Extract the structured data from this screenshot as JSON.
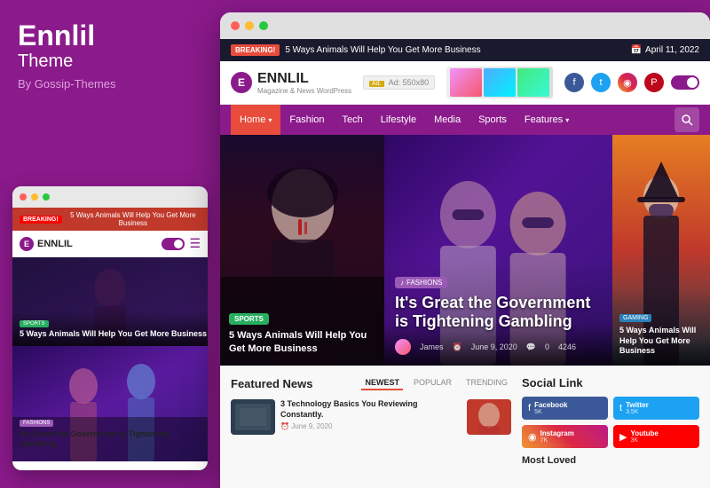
{
  "left": {
    "brand_name": "Ennlil",
    "brand_sub": "Theme",
    "brand_by": "By Gossip-Themes"
  },
  "mini_browser": {
    "breaking_badge": "BREAKING!",
    "breaking_text": "5 Ways Animals Will Help You Get More Business",
    "logo_letter": "E",
    "logo_text": "ENNLIL",
    "sports_badge": "SPORTS",
    "hero_title": "5 Ways Animals Will Help You Get More Business",
    "fashions_badge": "FASHIONS",
    "section_title": "It's Great the Government is Tightening Gambling"
  },
  "main_browser": {
    "breaking_badge": "BREAKING!",
    "breaking_text": "5 Ways Animals Will Help You Get More Business",
    "date": "April 11, 2022",
    "logo_letter": "E",
    "logo_text": "ENNLIL",
    "logo_sub": "Magazine & News WordPress",
    "ad_label": "Ad: 550x80",
    "nav_items": [
      {
        "label": "Home",
        "has_arrow": true,
        "active": false
      },
      {
        "label": "Fashion",
        "has_arrow": false,
        "active": false
      },
      {
        "label": "Tech",
        "has_arrow": false,
        "active": false
      },
      {
        "label": "Lifestyle",
        "has_arrow": false,
        "active": false
      },
      {
        "label": "Media",
        "has_arrow": false,
        "active": false
      },
      {
        "label": "Sports",
        "has_arrow": false,
        "active": false
      },
      {
        "label": "Features",
        "has_arrow": true,
        "active": false
      }
    ],
    "hero_left": {
      "badge": "SPORTS",
      "title": "5 Ways Animals Will Help You Get More Business"
    },
    "hero_center": {
      "badge": "FASHIONS",
      "title": "It's Great the Government is Tightening Gambling",
      "author": "James",
      "date": "June 9, 2020",
      "comments": "0",
      "views": "4246"
    },
    "hero_right": {
      "badge": "GAMING",
      "title": "5 Ways Animals Will Help You Get More Business"
    },
    "featured_news": {
      "title": "Featured News",
      "tabs": [
        {
          "label": "NEWEST",
          "active": true
        },
        {
          "label": "POPULAR",
          "active": false
        },
        {
          "label": "TRENDING",
          "active": false
        }
      ],
      "items": [
        {
          "title": "3 Technology Basics You Reviewing Constantly.",
          "date": "June 9, 2020"
        },
        {
          "title": "",
          "date": ""
        }
      ]
    },
    "social_links": {
      "title": "Social Link",
      "items": [
        {
          "platform": "Facebook",
          "count": "5K",
          "type": "fb"
        },
        {
          "platform": "Twitter",
          "count": "3.5K",
          "type": "tw"
        },
        {
          "platform": "Instagram",
          "count": "7K",
          "type": "ig"
        },
        {
          "platform": "Youtube",
          "count": "3K",
          "type": "yt"
        }
      ]
    },
    "most_loved": "Most Loved"
  }
}
